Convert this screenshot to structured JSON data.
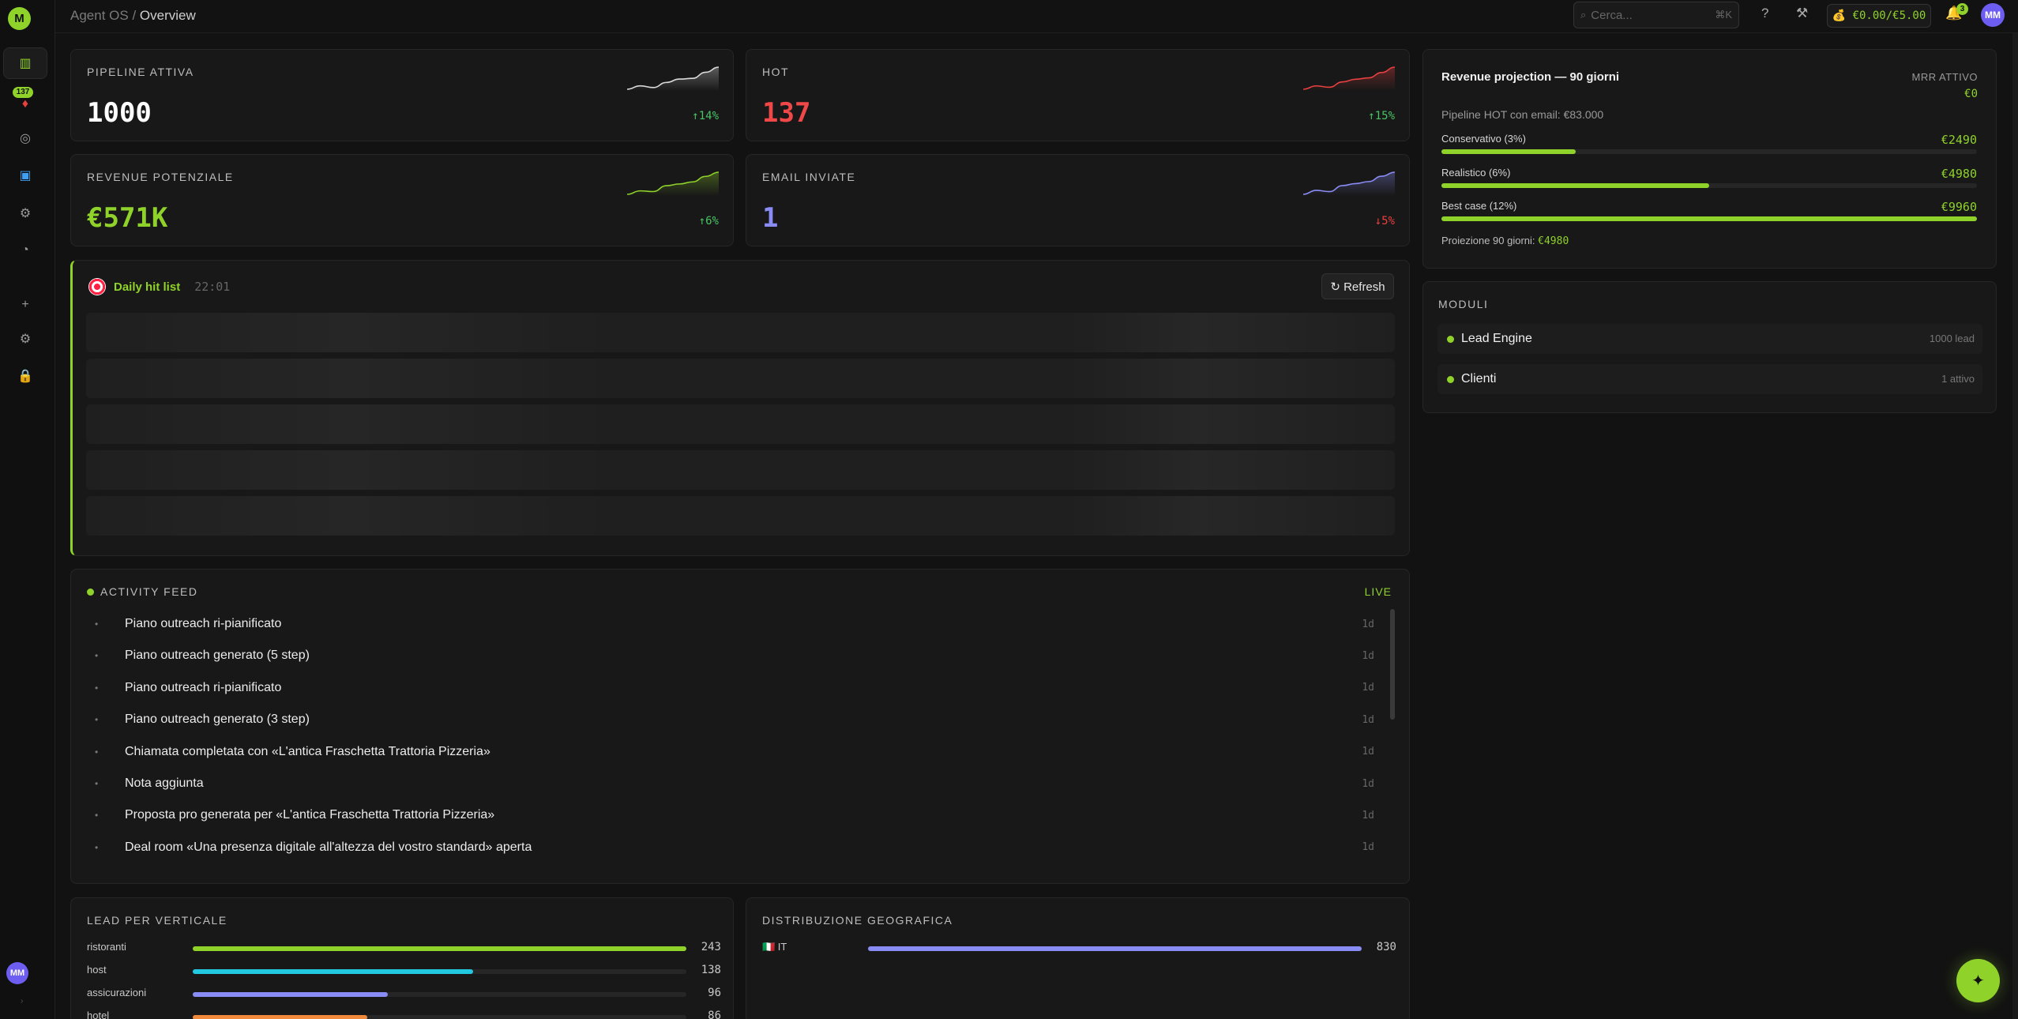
{
  "sidebar": {
    "logo": "M",
    "badge": "137",
    "avatar": "MM",
    "expand": "›"
  },
  "topbar": {
    "breadcrumb_root": "Agent OS",
    "breadcrumb_sep": "/",
    "breadcrumb_current": "Overview",
    "search_placeholder": "Cerca...",
    "search_shortcut": "⌘K",
    "help": "?",
    "budget": "💰 €0.00/€5.00",
    "notif_count": "3",
    "avatar": "MM"
  },
  "kpis": [
    {
      "label": "Pipeline attiva",
      "value": "1000",
      "delta": "↑14%",
      "delta_color": "#49c464",
      "value_color": "#ffffff",
      "spark_color": "#d9d9d9",
      "trend": [
        3,
        4,
        3.5,
        5,
        6,
        6.2,
        8,
        9.5
      ]
    },
    {
      "label": "HOT",
      "value": "137",
      "delta": "↑15%",
      "delta_color": "#49c464",
      "value_color": "#f04848",
      "spark_color": "#e84040",
      "trend": [
        3,
        4,
        3.6,
        5.2,
        6,
        6.4,
        8,
        9.6
      ]
    },
    {
      "label": "Revenue potenziale",
      "value": "€571K",
      "delta": "↑6%",
      "delta_color": "#49c464",
      "value_color": "#8fd22a",
      "spark_color": "#8fd22a",
      "trend": [
        3,
        4,
        3.8,
        5.5,
        6,
        6.6,
        8.2,
        9.4
      ]
    },
    {
      "label": "Email inviate",
      "value": "1",
      "delta": "↓5%",
      "delta_color": "#e84040",
      "value_color": "#8a8cf5",
      "spark_color": "#8a8cf5",
      "trend": [
        3,
        4.2,
        3.8,
        5.6,
        6.2,
        6.8,
        8.4,
        9.6
      ]
    }
  ],
  "hitlist": {
    "title": "Daily hit list",
    "time": "22:01",
    "refresh_label": "↻ Refresh"
  },
  "activity": {
    "title": "ACTIVITY FEED",
    "live": "LIVE",
    "items": [
      {
        "text": "Piano outreach ri-pianificato",
        "ago": "1d"
      },
      {
        "text": "Piano outreach generato (5 step)",
        "ago": "1d"
      },
      {
        "text": "Piano outreach ri-pianificato",
        "ago": "1d"
      },
      {
        "text": "Piano outreach generato (3 step)",
        "ago": "1d"
      },
      {
        "text": "Chiamata completata con «L'antica Fraschetta Trattoria Pizzeria»",
        "ago": "1d"
      },
      {
        "text": "Nota aggiunta",
        "ago": "1d"
      },
      {
        "text": "Proposta pro generata per «L'antica Fraschetta Trattoria Pizzeria»",
        "ago": "1d"
      },
      {
        "text": "Deal room «Una presenza digitale all'altezza del vostro standard» aperta",
        "ago": "1d"
      }
    ]
  },
  "verticals": {
    "title": "LEAD PER VERTICALE",
    "max": 243,
    "items": [
      {
        "label": "ristoranti",
        "value": 243,
        "color": "#8fd22a"
      },
      {
        "label": "host",
        "value": 138,
        "color": "#22c7e0"
      },
      {
        "label": "assicurazioni",
        "value": 96,
        "color": "#8a8cf5"
      },
      {
        "label": "hotel",
        "value": 86,
        "color": "#f08a3a"
      }
    ]
  },
  "geo": {
    "title": "DISTRIBUZIONE GEOGRAFICA",
    "max": 830,
    "items": [
      {
        "label": "🇮🇹 IT",
        "value": 830,
        "color": "#8a8cf5"
      }
    ]
  },
  "revenue": {
    "title": "Revenue projection — 90 giorni",
    "mrr_label": "MRR ATTIVO",
    "mrr_value": "€0",
    "hot_pipeline": "Pipeline HOT con email: €83.000",
    "scenarios": [
      {
        "label": "Conservativo (3%)",
        "value": "€2490",
        "fraction": 0.25
      },
      {
        "label": "Realistico (6%)",
        "value": "€4980",
        "fraction": 0.5
      },
      {
        "label": "Best case (12%)",
        "value": "€9960",
        "fraction": 1.0
      }
    ],
    "projection_label": "Proiezione 90 giorni:",
    "projection_value": "€4980"
  },
  "modules": {
    "title": "MODULI",
    "items": [
      {
        "name": "Lead Engine",
        "meta": "1000 lead"
      },
      {
        "name": "Clienti",
        "meta": "1 attivo"
      }
    ]
  },
  "fab_icon": "✦"
}
